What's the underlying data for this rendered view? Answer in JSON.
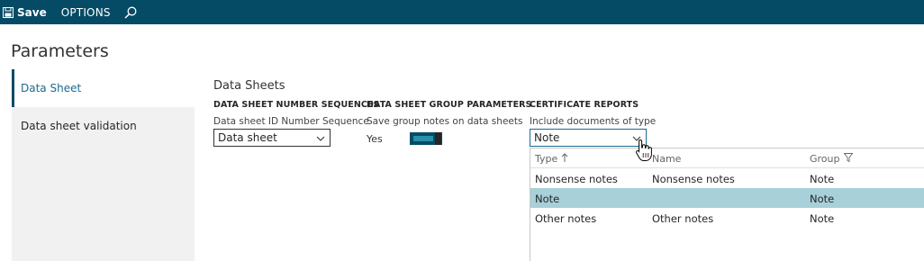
{
  "toolbar": {
    "save_label": "Save",
    "options_label": "OPTIONS",
    "save_icon": "floppy-disk-icon",
    "search_icon": "search-icon"
  },
  "page": {
    "title": "Parameters"
  },
  "nav": {
    "items": [
      {
        "label": "Data Sheet",
        "active": true
      },
      {
        "label": "Data sheet validation",
        "active": false
      }
    ]
  },
  "main": {
    "section_title": "Data Sheets",
    "groups": {
      "number_sequences": {
        "header": "DATA SHEET NUMBER SEQUENCES",
        "label": "Data sheet ID Number Sequence",
        "value": "Data sheet"
      },
      "group_parameters": {
        "header": "DATA SHEET GROUP PARAMETERS",
        "label": "Save group notes on data sheets",
        "toggle_text": "Yes",
        "toggle_on": true
      },
      "certificate_reports": {
        "header": "CERTIFICATE REPORTS",
        "label": "Include documents of type",
        "value": "Note"
      }
    }
  },
  "dropdown": {
    "columns": {
      "type": "Type",
      "name": "Name",
      "group": "Group"
    },
    "sort_icon": "sort-ascending-icon",
    "filter_icon": "filter-icon",
    "rows": [
      {
        "type": "Nonsense notes",
        "name": "Nonsense notes",
        "group": "Note",
        "selected": false
      },
      {
        "type": "Note",
        "name": "",
        "group": "Note",
        "selected": true
      },
      {
        "type": "Other notes",
        "name": "Other notes",
        "group": "Note",
        "selected": false
      }
    ]
  },
  "colors": {
    "topbar": "#054b66",
    "nav_background": "#f1f1f1",
    "selected_row": "#a7d0d9",
    "toggle": "#054b66"
  }
}
